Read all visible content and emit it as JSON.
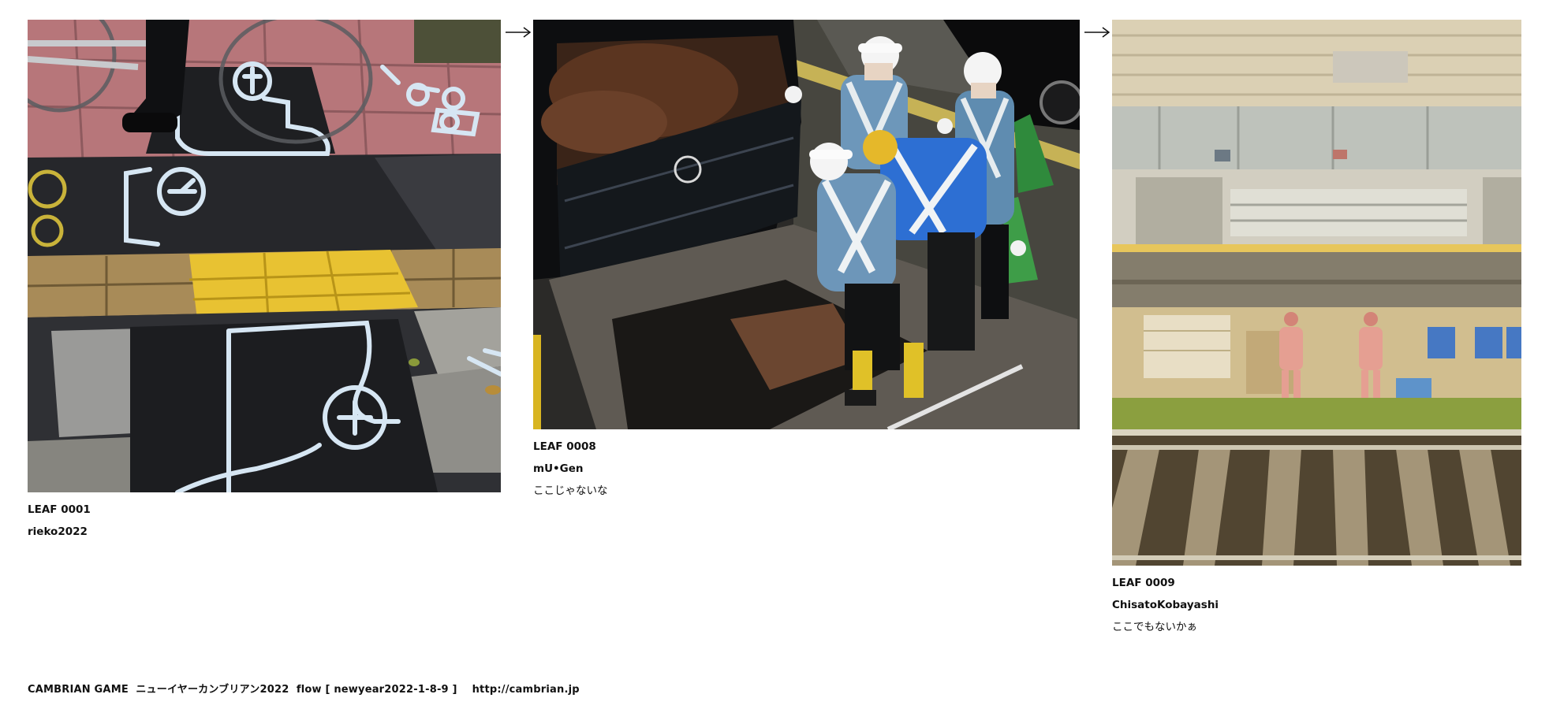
{
  "leaves": [
    {
      "id": "LEAF 0001",
      "author": "rieko2022",
      "comment": "",
      "photo_icon": "sidewalk-chalk-marks-photo"
    },
    {
      "id": "LEAF 0008",
      "author": "mU•Gen",
      "comment": "ここじゃないな",
      "photo_icon": "road-workers-photo"
    },
    {
      "id": "LEAF 0009",
      "author": "ChisatoKobayashi",
      "comment": "ここでもないかぁ",
      "photo_icon": "train-platform-photo"
    }
  ],
  "arrows": [
    "right-arrow-icon",
    "right-arrow-icon"
  ],
  "footer": {
    "text": "CAMBRIAN GAME  ニューイヤーカンブリアン2022  flow [ newyear2022-1-8-9 ]    http://cambrian.jp"
  },
  "colors": {
    "text": "#111111",
    "background": "#ffffff"
  }
}
